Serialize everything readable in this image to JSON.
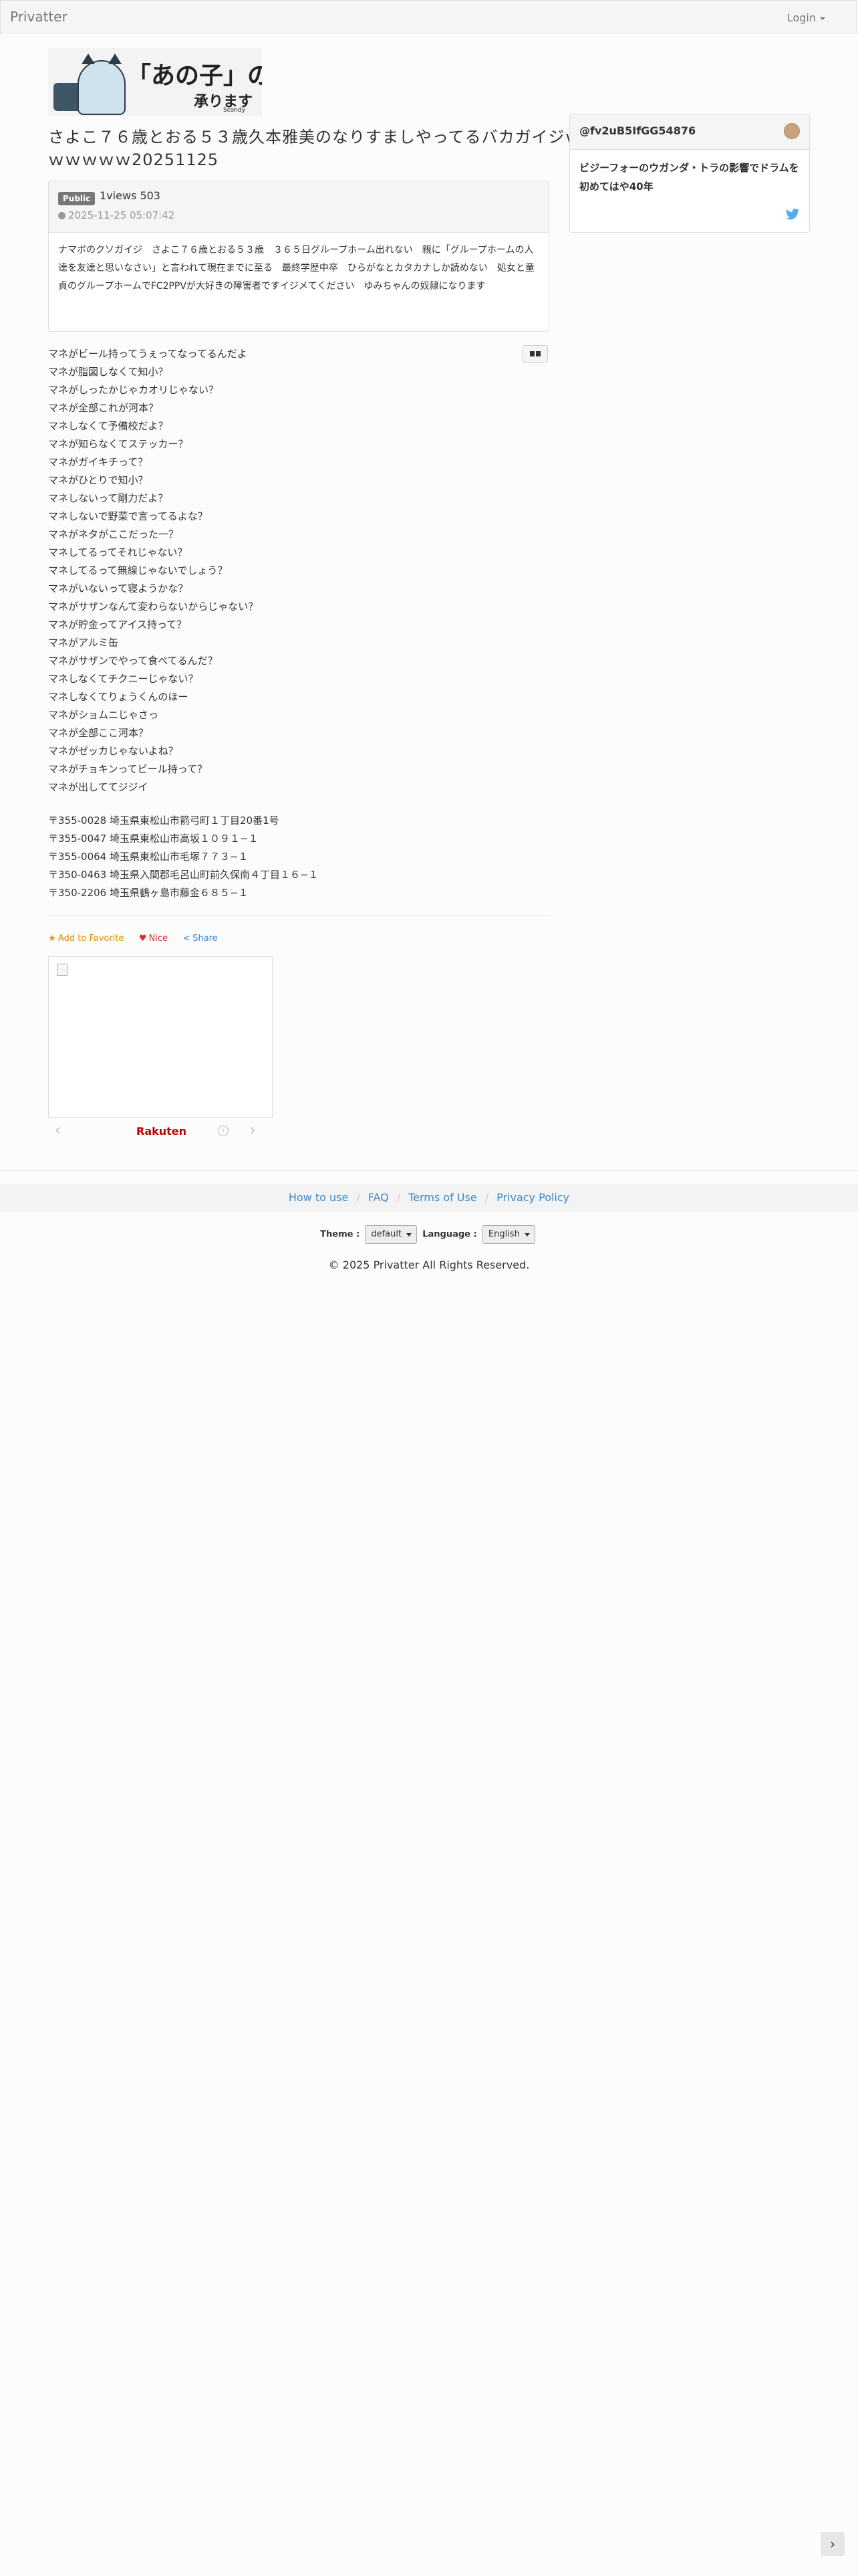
{
  "navbar": {
    "brand": "Privatter",
    "login": "Login"
  },
  "banner": {
    "title": "「あの子」の解釈",
    "subtitle": "承ります",
    "credit": "Scondy"
  },
  "post": {
    "title": "さよこ７６歳とおる５３歳久本雅美のなりすましやってるバカガイジｗｗｗｗｗｗ20251125",
    "visibility": "Public",
    "views": "1views 503",
    "date": "2025-11-25 05:07:42",
    "summary": "ナマポのクソガイジ　さよこ７６歳とおる５３歳　３６５日グループホーム出れない　親に「グループホームの人達を友達と思いなさい」と言われて現在までに至る　最終学歴中卒　ひらがなとカタカナしか読めない　処女と童貞のグループホームでFC2PPVが大好きの障害者ですイジメてください　ゆみちゃんの奴隷になります",
    "lines": [
      "マネがビール持ってうぇってなってるんだよ",
      "マネが脂図しなくて知小？",
      "マネがしったかじゃカオリじゃない？",
      "マネが全部これが河本？",
      "マネしなくて予備校だよ？",
      "マネが知らなくてステッカー？",
      "マネがガイキチって？",
      "マネがひとりで知小？",
      "マネしないって剛力だよ？",
      "マネしないで野菜で言ってるよな？",
      "マネがネタがここだった一？",
      "マネしてるってそれじゃない？",
      "マネしてるって無線じゃないでしょう？",
      "マネがいないって寝ようかな？",
      "マネがサザンなんて変わらないからじゃない？",
      "マネが貯金ってアイス持って？",
      "マネがアルミ缶",
      "マネがサザンでやって食べてるんだ？",
      "マネしなくてチクニーじゃない？",
      "マネしなくてりょうくんのほー",
      "マネがショムニじゃさっ",
      "マネが全部ここ河本？",
      "マネがゼッカじゃないよね？",
      "マネがチョキンってビール持って？",
      "マネが出しててジジイ"
    ],
    "addresses": [
      "〒355-0028 埼玉県東松山市箭弓町１丁目20番1号",
      "〒355-0047 埼玉県東松山市高坂１０９１−１",
      "〒355-0064 埼玉県東松山市毛塚７７３−１",
      "〒350-0463 埼玉県入間郡毛呂山町前久保南４丁目１６−１",
      "〒350-2206 埼玉県鶴ヶ島市藤金６８５−１"
    ]
  },
  "actions": {
    "favorite": "Add to Favorite",
    "nice": "Nice",
    "share": "Share"
  },
  "ad": {
    "brand": "Rakuten",
    "info": "i"
  },
  "sidebar": {
    "username": "@fv2uB5IfGG54876",
    "text": "ビジーフォーのウガンダ・トラの影響でドラムを初めてはや40年"
  },
  "footer": {
    "links": [
      "How to use",
      "FAQ",
      "Terms of Use",
      "Privacy Policy"
    ],
    "theme_label": "Theme :",
    "theme_value": "default",
    "language_label": "Language :",
    "language_value": "English",
    "copyright": "© 2025 Privatter All Rights Reserved."
  }
}
